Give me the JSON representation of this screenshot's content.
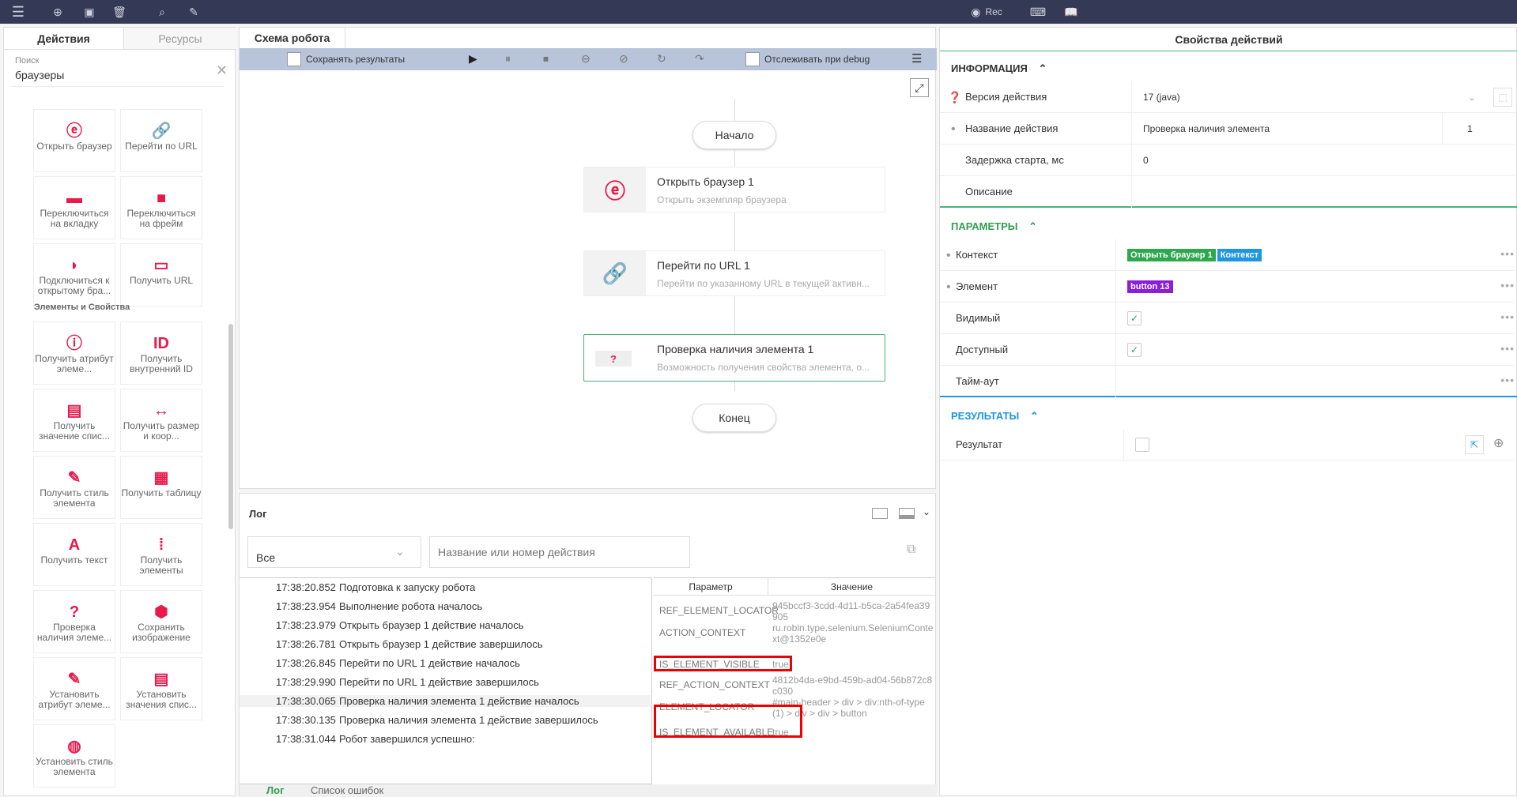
{
  "toolbar": {
    "menu_icon": "hamburger-icon",
    "rec_label": "Rec"
  },
  "left": {
    "tabs": [
      "Действия",
      "Ресурсы"
    ],
    "search_label": "Поиск",
    "search_value": "браузеры",
    "section_label": "Элементы и Свойства",
    "cards": [
      {
        "label": "Открыть браузер",
        "icon": "browser-e-icon"
      },
      {
        "label": "Перейти по URL",
        "icon": "link-icon"
      },
      {
        "label": "Переключиться на вкладку",
        "icon": "tab-icon"
      },
      {
        "label": "Переключиться на фрейм",
        "icon": "frame-icon"
      },
      {
        "label": "Подключиться к открытому бра...",
        "icon": "connect-icon"
      },
      {
        "label": "Получить URL",
        "icon": "get-url-icon"
      },
      {
        "label": "Получить атрибут элеме...",
        "icon": "attribute-icon"
      },
      {
        "label": "Получить внутренний ID",
        "icon": "id-icon"
      },
      {
        "label": "Получить значение спис...",
        "icon": "list-value-icon"
      },
      {
        "label": "Получить размер и коор...",
        "icon": "size-icon"
      },
      {
        "label": "Получить стиль элемента",
        "icon": "style-icon"
      },
      {
        "label": "Получить таблицу",
        "icon": "table-icon"
      },
      {
        "label": "Получить текст",
        "icon": "text-icon"
      },
      {
        "label": "Получить элементы",
        "icon": "elements-icon"
      },
      {
        "label": "Проверка наличия элеме...",
        "icon": "question-icon"
      },
      {
        "label": "Сохранить изображение",
        "icon": "save-image-icon"
      },
      {
        "label": "Установить атрибут элеме...",
        "icon": "set-attr-icon"
      },
      {
        "label": "Установить значения спис...",
        "icon": "set-list-icon"
      },
      {
        "label": "Установить стиль элемента",
        "icon": "set-style-icon"
      }
    ]
  },
  "center": {
    "tab": "Схема робота",
    "save_results": "Сохранять результаты",
    "track_debug": "Отслеживать при debug",
    "start": "Начало",
    "end": "Конец",
    "nodes": [
      {
        "title": "Открыть браузер  1",
        "desc": "Открыть экземпляр браузера"
      },
      {
        "title": "Перейти по URL  1",
        "desc": "Перейти по указанному URL в текущей активн..."
      },
      {
        "title": "Проверка наличия элемента  1",
        "desc": "Возможность получения свойства элемента, о..."
      }
    ]
  },
  "log": {
    "title": "Лог",
    "filter": "Все",
    "search_placeholder": "Название или номер действия",
    "rows": [
      {
        "time": "17:38:20.852",
        "msg": "Подготовка к запуску робота"
      },
      {
        "time": "17:38:23.954",
        "msg": "Выполнение робота началось"
      },
      {
        "time": "17:38:23.979",
        "msg": "Открыть браузер 1 действие началось"
      },
      {
        "time": "17:38:26.781",
        "msg": "Открыть браузер 1 действие завершилось"
      },
      {
        "time": "17:38:26.845",
        "msg": "Перейти по URL 1 действие началось"
      },
      {
        "time": "17:38:29.990",
        "msg": "Перейти по URL 1 действие завершилось"
      },
      {
        "time": "17:38:30.065",
        "msg": "Проверка наличия элемента 1 действие началось"
      },
      {
        "time": "17:38:30.135",
        "msg": "Проверка наличия элемента 1 действие завершилось"
      },
      {
        "time": "17:38:31.044",
        "msg": "Робот завершился успешно:"
      }
    ],
    "param_header": "Параметр",
    "value_header": "Значение",
    "params": [
      {
        "name": "REF_ELEMENT_LOCATOR",
        "value": "945bccf3-3cdd-4d11-b5ca-2a54fea39905"
      },
      {
        "name": "ACTION_CONTEXT",
        "value": "ru.robin.type.selenium.SeleniumContext@1352e0e"
      },
      {
        "name": "IS_ELEMENT_VISIBLE",
        "value": "true"
      },
      {
        "name": "REF_ACTION_CONTEXT",
        "value": "4812b4da-e9bd-459b-ad04-56b872c8c030"
      },
      {
        "name": "ELEMENT_LOCATOR",
        "value": "#main-header > div > div:nth-of-type(1) > div > div > button"
      },
      {
        "name": "IS_ELEMENT_AVAILABLE",
        "value": "true"
      }
    ],
    "bottom_tabs": [
      "Лог",
      "Список ошибок"
    ]
  },
  "right": {
    "title": "Свойства действий",
    "info": "ИНФОРМАЦИЯ",
    "params": "ПАРАМЕТРЫ",
    "results": "РЕЗУЛЬТАТЫ",
    "version_label": "Версия действия",
    "version_value": "17 (java)",
    "name_label": "Название действия",
    "name_value": "Проверка наличия элемента",
    "name_num": "1",
    "delay_label": "Задержка старта, мс",
    "delay_value": "0",
    "desc_label": "Описание",
    "context_label": "Контекст",
    "context_tag1": "Открыть браузер 1",
    "context_tag2": "Контекст",
    "element_label": "Элемент",
    "element_tag": "button 13",
    "visible_label": "Видимый",
    "available_label": "Доступный",
    "timeout_label": "Тайм-аут",
    "result_label": "Результат"
  }
}
